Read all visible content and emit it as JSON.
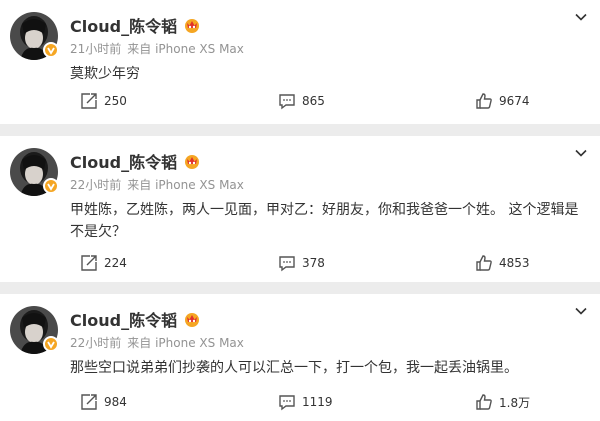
{
  "colors": {
    "accent": "#f5a623",
    "gray": "#939393",
    "text": "#333333",
    "separator": "#ececec"
  },
  "posts": [
    {
      "author": "Cloud_陈令韬",
      "time": "21小时前",
      "source": "来自 iPhone XS Max",
      "content": "莫欺少年穷",
      "repost_count": "250",
      "comment_count": "865",
      "like_count": "9674",
      "icons": {
        "repost": "repost-icon",
        "comment": "comment-icon",
        "like": "thumbs-up-icon",
        "menu": "chevron-down-icon"
      }
    },
    {
      "author": "Cloud_陈令韬",
      "time": "22小时前",
      "source": "来自 iPhone XS Max",
      "content": "甲姓陈，乙姓陈，两人一见面，甲对乙：好朋友，你和我爸爸一个姓。 这个逻辑是不是欠？",
      "repost_count": "224",
      "comment_count": "378",
      "like_count": "4853",
      "icons": {
        "repost": "repost-icon",
        "comment": "comment-icon",
        "like": "thumbs-up-icon",
        "menu": "chevron-down-icon"
      }
    },
    {
      "author": "Cloud_陈令韬",
      "time": "22小时前",
      "source": "来自 iPhone XS Max",
      "content": "那些空口说弟弟们抄袭的人可以汇总一下，打一个包，我一起丢油锅里。",
      "repost_count": "984",
      "comment_count": "1119",
      "like_count": "1.8万",
      "icons": {
        "repost": "repost-icon",
        "comment": "comment-icon",
        "like": "thumbs-up-icon",
        "menu": "chevron-down-icon"
      }
    }
  ]
}
